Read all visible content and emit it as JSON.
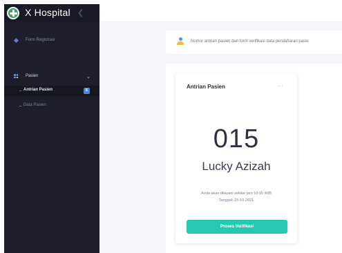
{
  "brand": {
    "title": "X Hospital",
    "toggle_icon": "chevron-left-icon"
  },
  "sidebar": {
    "form_registrasi": {
      "label": "Form Registrasi",
      "icon": "diamond-icon"
    },
    "pasien": {
      "label": "Pasien",
      "icon": "grid-icon",
      "expanded": true,
      "children": [
        {
          "label": "Antrian Pasien",
          "badge": "6",
          "active": true
        },
        {
          "label": "Data Pasien",
          "active": false
        }
      ]
    }
  },
  "alert": {
    "text": "Nomor antrian pasien dan form verifikasi data pendaftaran pasie"
  },
  "card": {
    "title": "Antrian Pasien",
    "more_label": "...",
    "queue_number": "015",
    "patient_name": "Lucky Azizah",
    "serve_text": "Anda akan dilayani sekitar jam 10:15 WIB",
    "date_text": "Tanggal: 15-10-2021",
    "button_label": "Proses Verifikasi"
  },
  "colors": {
    "sidebar_bg": "#1e1f2b",
    "accent_teal": "#27c7b6",
    "badge_blue": "#3f8cf2",
    "content_bg": "#f4f5f8"
  }
}
